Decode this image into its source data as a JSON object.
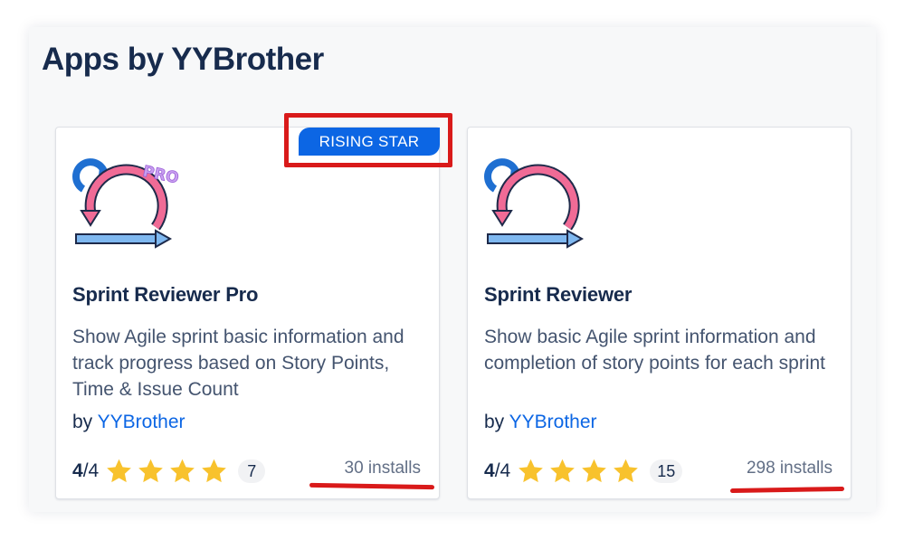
{
  "page": {
    "heading": "Apps by YYBrother"
  },
  "apps": [
    {
      "badge": "RISING STAR",
      "title": "Sprint Reviewer Pro",
      "description": "Show Agile sprint basic information and track progress based on Story Points, Time & Issue Count",
      "by_label": "by",
      "vendor": "YYBrother",
      "rating_score": "4",
      "rating_total": "/4",
      "stars": 4,
      "review_count": "7",
      "installs": "30 installs",
      "logo_badge_text": "PRO",
      "icon": "sprint-cycle-arrow-icon"
    },
    {
      "title": "Sprint Reviewer",
      "description": "Show basic Agile sprint information and completion of story points for each sprint",
      "by_label": "by",
      "vendor": "YYBrother",
      "rating_score": "4",
      "rating_total": "/4",
      "stars": 4,
      "review_count": "15",
      "installs": "298 installs",
      "icon": "sprint-cycle-arrow-icon"
    }
  ],
  "colors": {
    "badge": "#0c66e4",
    "highlight": "#d91a1a",
    "star": "#f8c22d",
    "link": "#0c66e4"
  }
}
